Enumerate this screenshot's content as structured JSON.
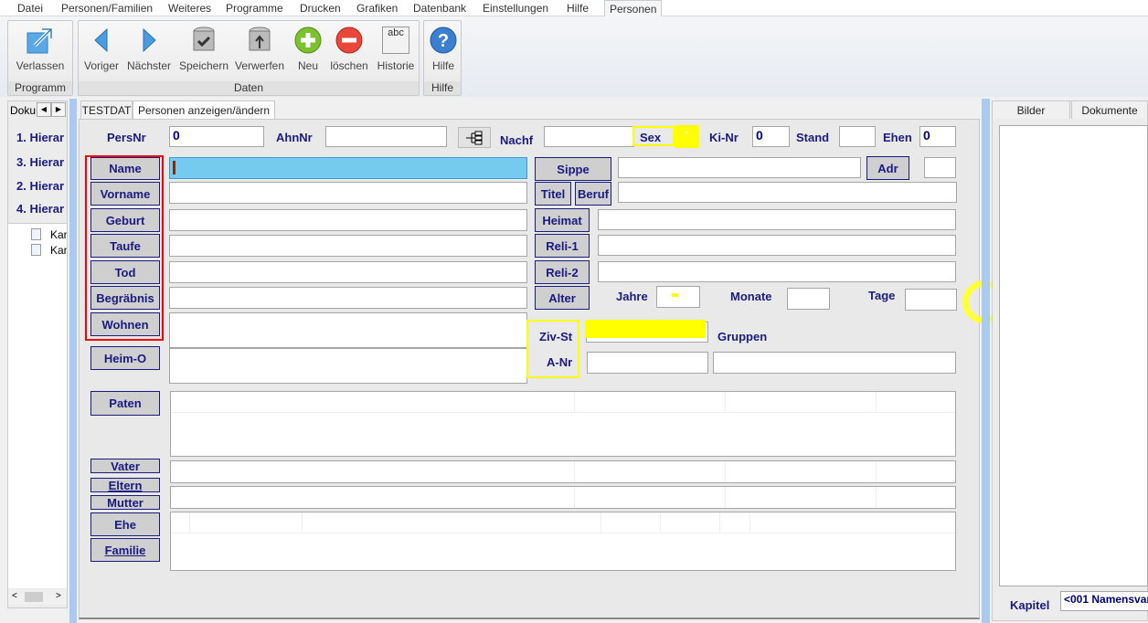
{
  "menu": [
    "Datei",
    "Personen/Familien",
    "Weiteres",
    "Programme",
    "Drucken",
    "Grafiken",
    "Datenbank",
    "Einstellungen",
    "Hilfe",
    "Personen"
  ],
  "ribbon": {
    "groups": {
      "programm": "Programm",
      "daten": "Daten",
      "hilfe": "Hilfe"
    },
    "buttons": {
      "verlassen": "Verlassen",
      "voriger": "Voriger",
      "naechster": "Nächster",
      "speichern": "Speichern",
      "verwerfen": "Verwerfen",
      "neu": "Neu",
      "loeschen": "löschen",
      "historie": "Historie",
      "hilfe": "Hilfe"
    },
    "historie_icon_text": "abc"
  },
  "left": {
    "tab": "Doku",
    "items": [
      "1. Hierar",
      "3. Hierar",
      "2. Hierar",
      "4. Hierar"
    ],
    "tree": [
      "Kar",
      "Kar"
    ]
  },
  "main": {
    "tabs": [
      "TESTDAT",
      "Personen anzeigen/ändern"
    ]
  },
  "form": {
    "persnr_label": "PersNr",
    "persnr": "0",
    "ahnnr_label": "AhnNr",
    "ahnnr": "",
    "nachf_label": "Nachf",
    "sex_label": "Sex",
    "sex": "-",
    "kinr_label": "Ki-Nr",
    "kinr": "0",
    "stand_label": "Stand",
    "ehen_label": "Ehen",
    "ehen": "0",
    "left_buttons": [
      "Name",
      "Vorname",
      "Geburt",
      "Taufe",
      "Tod",
      "Begräbnis",
      "Wohnen",
      "Heim-O"
    ],
    "mid_buttons": {
      "sippe": "Sippe",
      "titel": "Titel",
      "beruf": "Beruf",
      "heimat": "Heimat",
      "reli1": "Reli-1",
      "reli2": "Reli-2",
      "alter": "Alter",
      "adr": "Adr"
    },
    "jahre_label": "Jahre",
    "monate_label": "Monate",
    "tage_label": "Tage",
    "zivst_label": "Ziv-St",
    "gruppen_label": "Gruppen",
    "anr_label": "A-Nr",
    "rel_buttons": {
      "paten": "Paten",
      "vater": "Vater",
      "eltern": "Eltern",
      "mutter": "Mutter",
      "ehe": "Ehe",
      "familie": "Familie"
    }
  },
  "right": {
    "tabs": [
      "Bilder",
      "Dokumente"
    ],
    "kapitel_label": "Kapitel",
    "kapitel": "<001 Namensvar"
  },
  "colors": {
    "highlight": "#ffff00",
    "annotation_red": "#ff0000",
    "label": "#1a1a80",
    "active_input": "#74cbef"
  }
}
